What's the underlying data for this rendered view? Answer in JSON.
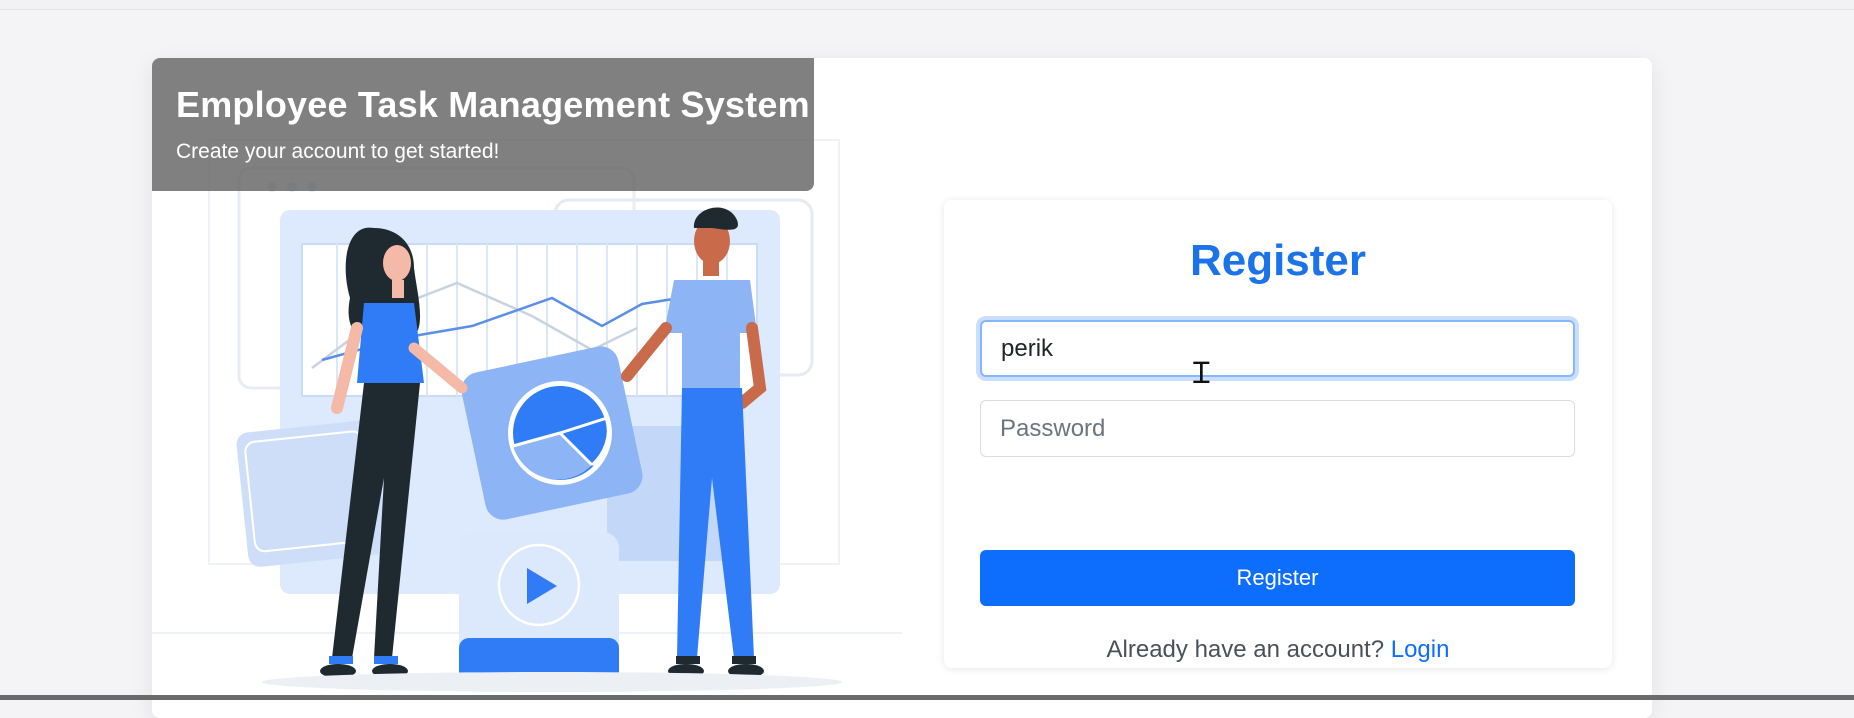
{
  "banner": {
    "title": "Employee Task Management System",
    "subtitle": "Create your account to get started!"
  },
  "form": {
    "title": "Register",
    "username": {
      "value": "perik"
    },
    "password": {
      "value": "",
      "placeholder": "Password"
    },
    "submit_label": "Register",
    "footer_text": "Already have an account?",
    "login_link": "Login"
  },
  "colors": {
    "accent": "#0d6efd",
    "title": "#1a73e8",
    "banner_bg": "#646464",
    "illustration_blue": "#2f7cf6",
    "illustration_dark": "#1f2a30"
  },
  "icons": [
    "pie-chart-icon",
    "play-icon",
    "text-cursor-icon"
  ]
}
